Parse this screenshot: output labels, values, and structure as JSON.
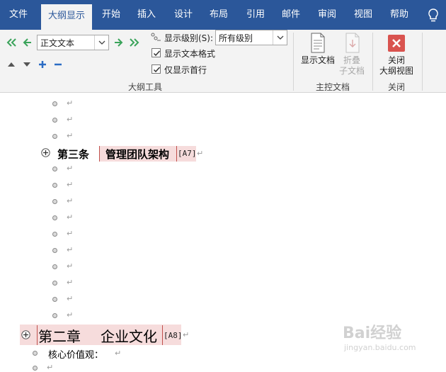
{
  "tabs": [
    {
      "label": "文件",
      "active": false
    },
    {
      "label": "大纲显示",
      "active": true
    },
    {
      "label": "开始",
      "active": false
    },
    {
      "label": "插入",
      "active": false
    },
    {
      "label": "设计",
      "active": false
    },
    {
      "label": "布局",
      "active": false
    },
    {
      "label": "引用",
      "active": false
    },
    {
      "label": "邮件",
      "active": false
    },
    {
      "label": "审阅",
      "active": false
    },
    {
      "label": "视图",
      "active": false
    },
    {
      "label": "帮助",
      "active": false
    }
  ],
  "ribbon": {
    "outline_tools": {
      "level_select_value": "正文文本",
      "show_level_label": "显示级别(S):",
      "show_level_value": "所有级别",
      "show_text_format_label": "显示文本格式",
      "show_text_format_checked": true,
      "show_first_line_label": "仅显示首行",
      "show_first_line_checked": true,
      "group_label": "大纲工具"
    },
    "master_document": {
      "show_document_label": "显示文档",
      "collapse_subdocs_label": "折叠\n子文档",
      "group_label": "主控文档"
    },
    "close": {
      "close_outline_label": "关闭\n大纲视图",
      "group_label": "关闭"
    }
  },
  "document": {
    "para_mark": "↵",
    "article3": {
      "num": "第三条",
      "title": "管理团队架构",
      "tag": "[A7]"
    },
    "chapter2": {
      "num": "第二章",
      "title": "企业文化",
      "tag": "[A8]"
    },
    "core_values": "核心价值观："
  },
  "watermark": {
    "text": "Bai经验",
    "url": "jingyan.baidu.com"
  },
  "colors": {
    "ribbon_blue": "#2b579a",
    "highlight": "#f6dcdc",
    "accent_red": "#c0504d"
  }
}
